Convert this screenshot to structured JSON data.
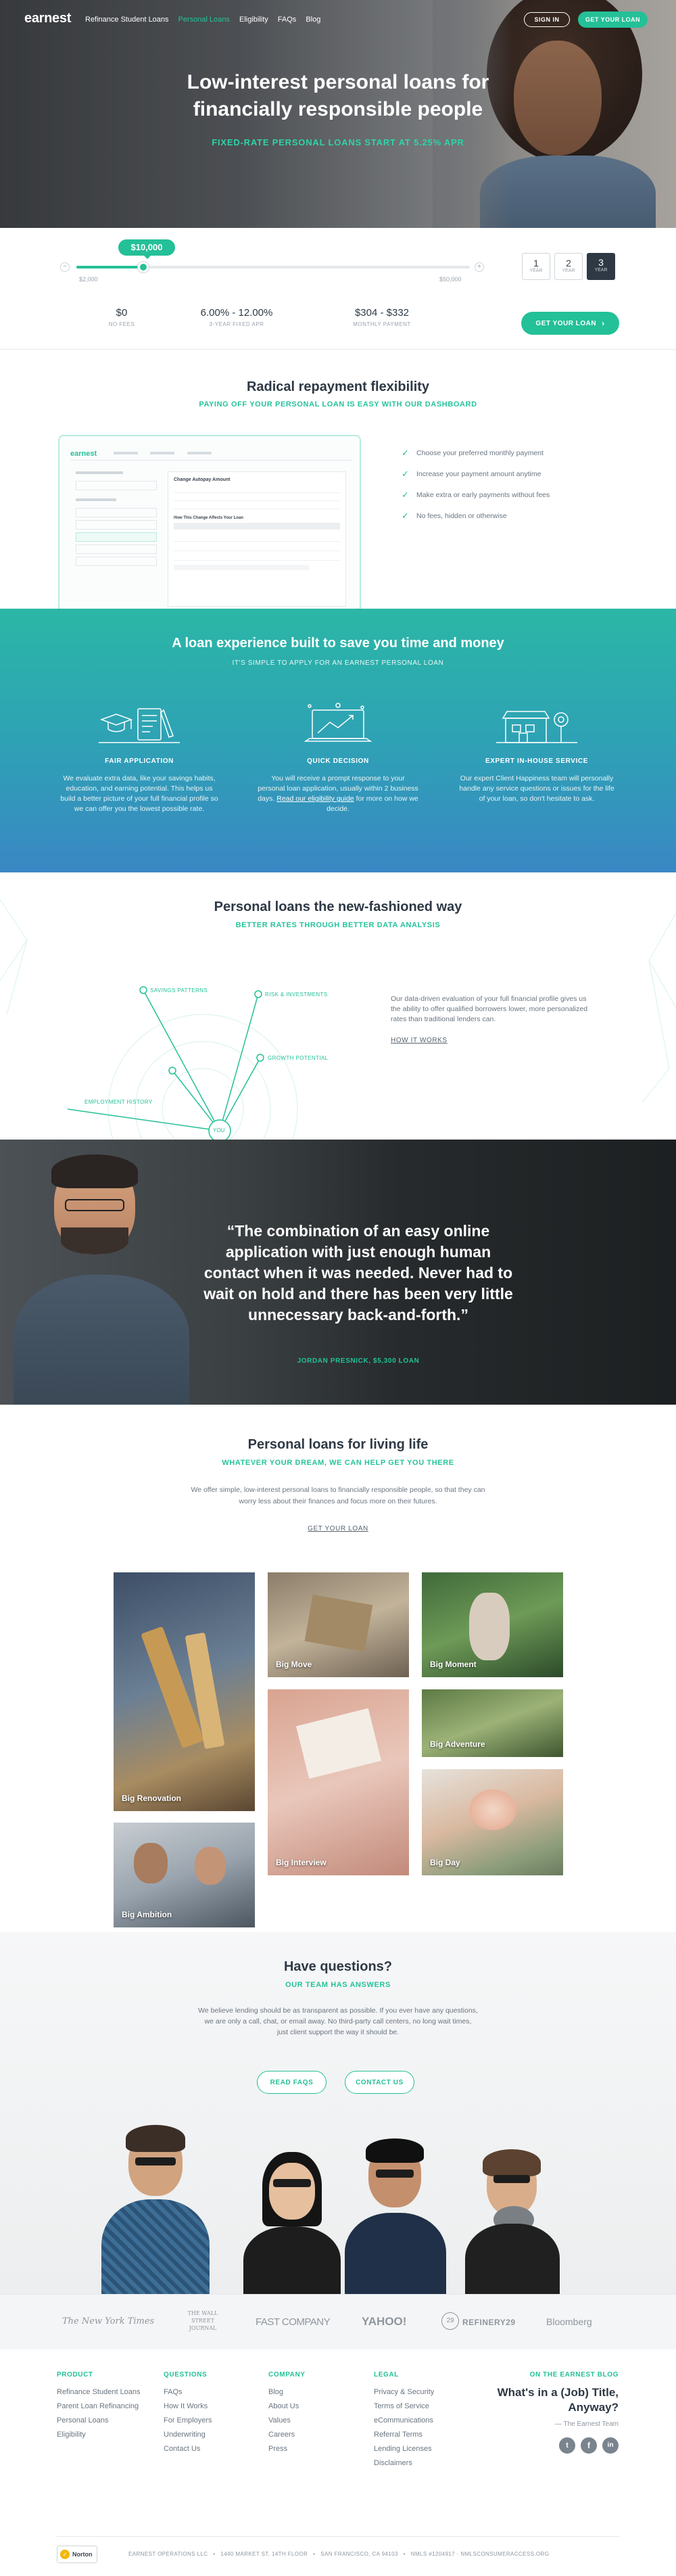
{
  "header": {
    "logo": "earnest",
    "nav": [
      "Refinance Student Loans",
      "Personal Loans",
      "Eligibility",
      "FAQs",
      "Blog"
    ],
    "sign_in": "SIGN IN",
    "get_loan": "GET YOUR LOAN"
  },
  "hero": {
    "title_line1": "Low-interest personal loans for",
    "title_line2": "financially responsible people",
    "subtitle": "FIXED-RATE PERSONAL LOANS START AT 5.25% APR"
  },
  "calculator": {
    "amount_bubble": "$10,000",
    "min_label": "$2,000",
    "max_label": "$50,000",
    "slider_fraction": 0.17,
    "terms": [
      {
        "num": "1",
        "unit": "YEAR"
      },
      {
        "num": "2",
        "unit": "YEAR"
      },
      {
        "num": "3",
        "unit": "YEAR"
      }
    ],
    "stats": [
      {
        "value": "$0",
        "label": "NO FEES"
      },
      {
        "value": "6.00% - 12.00%",
        "label": "3-YEAR FIXED APR"
      },
      {
        "value": "$304 - $332",
        "label": "MONTHLY PAYMENT"
      }
    ],
    "cta": "GET YOUR LOAN"
  },
  "flex": {
    "title": "Radical repayment flexibility",
    "subtitle": "PAYING OFF YOUR PERSONAL LOAN IS EASY WITH OUR DASHBOARD",
    "checklist": [
      "Choose your preferred monthly payment",
      "Increase your payment amount anytime",
      "Make extra or early payments without fees",
      "No fees, hidden or otherwise"
    ],
    "mock": {
      "logo": "earnest",
      "panel_title": "Change Autopay Amount",
      "table_title": "How This Change Affects Your Loan"
    }
  },
  "experience": {
    "title": "A loan experience built to save you time and money",
    "subtitle": "IT'S SIMPLE TO APPLY FOR AN EARNEST PERSONAL LOAN",
    "cols": [
      {
        "heading": "FAIR APPLICATION",
        "body": "We evaluate extra data, like your savings habits, education, and earning potential. This helps us build a better picture of your full financial profile so we can offer you the lowest possible rate."
      },
      {
        "heading": "QUICK DECISION",
        "body_pre": "You will receive a prompt response to your personal loan application, usually within 2 business days.",
        "link": "Read our eligibility guide",
        "body_post": "for more on how we decide."
      },
      {
        "heading": "EXPERT IN-HOUSE SERVICE",
        "body": "Our expert Client Happiness team will personally handle any service questions or issues for the life of your loan, so don't hesitate to ask."
      }
    ]
  },
  "newway": {
    "title": "Personal loans the new-fashioned way",
    "subtitle": "BETTER RATES THROUGH BETTER DATA ANALYSIS",
    "nodes": [
      "SAVINGS PATTERNS",
      "RISK & INVESTMENTS",
      "GROWTH POTENTIAL",
      "EMPLOYMENT HISTORY",
      "YOU"
    ],
    "body": "Our data-driven evaluation of your full financial profile gives us the ability to offer qualified borrowers lower, more personalized rates than traditional lenders can.",
    "link": "HOW IT WORKS"
  },
  "quote": {
    "line1": "“The combination of an easy online",
    "line2": "application with just enough human",
    "line3": "contact when it was needed. Never had to",
    "line4": "wait on hold and there has been very little",
    "line5": "unnecessary back-and-forth.”",
    "author": "JORDAN PRESNICK, $5,300 LOAN"
  },
  "living": {
    "title": "Personal loans for living life",
    "subtitle": "WHATEVER YOUR DREAM, WE CAN HELP GET YOU THERE",
    "body_line1": "We offer simple, low-interest personal loans to financially responsible people, so that they can",
    "body_line2": "worry less about their finances and focus more on their futures.",
    "link": "GET YOUR LOAN",
    "tiles": [
      "Big Renovation",
      "Big Move",
      "Big Moment",
      "Big Adventure",
      "Big Ambition",
      "Big Interview",
      "Big Day"
    ]
  },
  "questions": {
    "title": "Have questions?",
    "subtitle": "OUR TEAM HAS ANSWERS",
    "body_line1": "We believe lending should be as transparent as possible. If you ever have any questions,",
    "body_line2": "we are only a call, chat, or email away. No third-party call centers, no long wait times,",
    "body_line3": "just client support the way it should be.",
    "read_faqs": "READ FAQS",
    "contact": "CONTACT US"
  },
  "press": [
    "The New York Times",
    "THE WALL STREET JOURNAL",
    "FAST COMPANY",
    "YAHOO!",
    "REFINERY29",
    "Bloomberg"
  ],
  "footer": {
    "cols": [
      {
        "heading": "PRODUCT",
        "items": [
          "Refinance Student Loans",
          "Parent Loan Refinancing",
          "Personal Loans",
          "Eligibility"
        ]
      },
      {
        "heading": "QUESTIONS",
        "items": [
          "FAQs",
          "How It Works",
          "For Employers",
          "Underwriting",
          "Contact Us"
        ]
      },
      {
        "heading": "COMPANY",
        "items": [
          "Blog",
          "About Us",
          "Values",
          "Careers",
          "Press"
        ]
      },
      {
        "heading": "LEGAL",
        "items": [
          "Privacy & Security",
          "Terms of Service",
          "eCommunications",
          "Referral Terms",
          "Lending Licenses",
          "Disclaimers"
        ]
      }
    ],
    "blog_heading": "ON THE EARNEST BLOG",
    "blog_title_line1": "What's in a (Job) Title,",
    "blog_title_line2": "Anyway?",
    "blog_author": "The Earnest Team",
    "social": [
      "t",
      "f",
      "in"
    ],
    "norton": "Norton",
    "address": "EARNEST OPERATIONS LLC   •   1440 MARKET ST, 14TH FLOOR   •   SAN FRANCISCO, CA 94103   •   NMLS #1204917 · NMLSCONSUMERACCESS.ORG"
  },
  "colors": {
    "accent": "#24c097",
    "dark": "#2e3945",
    "blue": "#3a8fc8"
  }
}
